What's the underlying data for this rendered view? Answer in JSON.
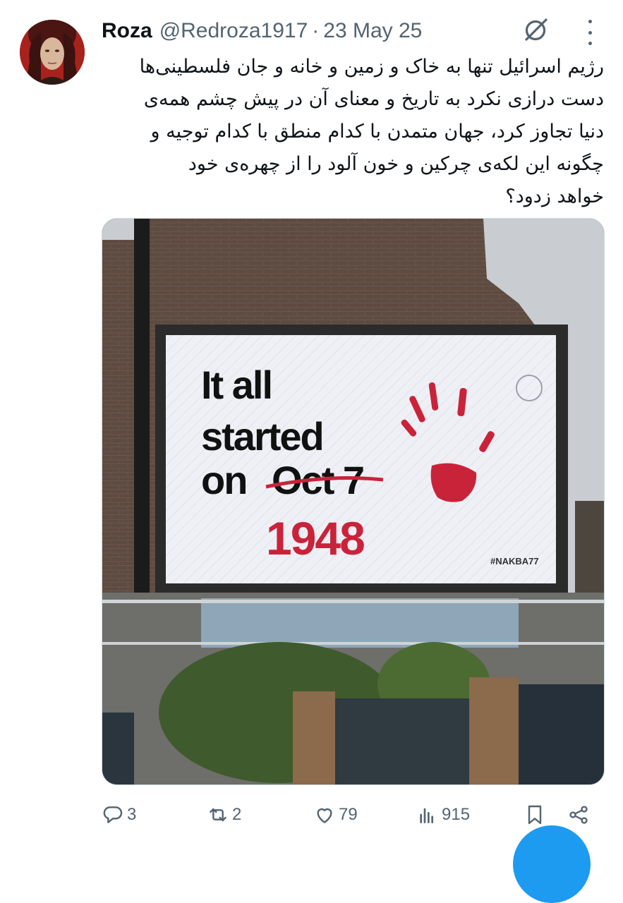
{
  "tweet": {
    "author_name": "Roza",
    "author_handle": "@Redroza1917",
    "separator": "·",
    "date": "23 May 25",
    "text": "رژیم اسرائیل تنها به خاک و زمین و خانه و جان فلسطینی‌ها\nدست درازی نکرد به تاریخ و معنای آن در پیش چشم همه‌ی\nدنیا تجاوز کرد، جهان متمدن با کدام منطق با کدام توجیه و\nچگونه این لکه‌ی چرکین و خون آلود را از چهره‌ی خود\nخواهد زدود؟"
  },
  "billboard": {
    "line1": "It all",
    "line2": "started",
    "line3_prefix": "on",
    "struck": "Oct 7",
    "year": "1948",
    "hashtag": "#NAKBA77"
  },
  "actions": {
    "replies": "3",
    "reposts": "2",
    "likes": "79",
    "views": "915"
  },
  "icons": {
    "grok": "grok-icon",
    "more": "more-icon",
    "reply": "reply-icon",
    "repost": "repost-icon",
    "like": "heart-icon",
    "views": "views-icon",
    "bookmark": "bookmark-icon",
    "share": "share-icon"
  },
  "colors": {
    "accent": "#1d9bf0",
    "muted": "#536471",
    "billboard_red": "#c9233a"
  }
}
